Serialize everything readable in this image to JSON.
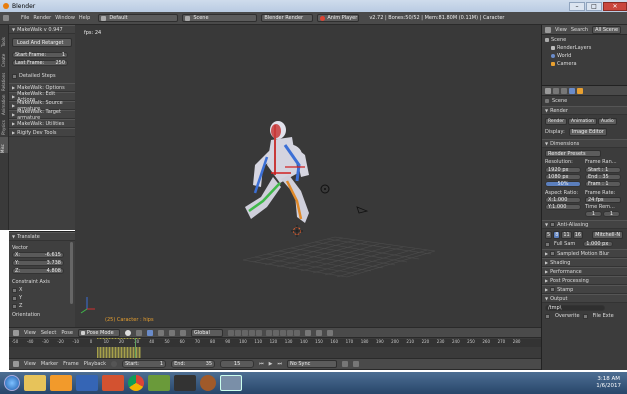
{
  "window": {
    "title": "Blender"
  },
  "menubar": {
    "menus": [
      "File",
      "Render",
      "Window",
      "Help"
    ],
    "layout": "Default",
    "scene": "Scene",
    "engine": "Blender Render",
    "anim_player": "Anim Player",
    "stats": "v2.72 | Bones:50/52 | Mem:81.80M (0.11M) | Caracter"
  },
  "tool_shelf": {
    "tabs": [
      "Tools",
      "Create",
      "Relations",
      "Animation",
      "Physics",
      "Misc"
    ],
    "makewalk_header": "MakeWalk v 0.947",
    "load_retarget": "Load And Retarget",
    "start_frame_label": "Start Frame:",
    "start_frame_value": "1",
    "last_frame_label": "Last Frame:",
    "last_frame_value": "250",
    "detailed_steps": "Detailed Steps",
    "panels": [
      "MakeWalk: Options",
      "MakeWalk: Edit Actions",
      "MakeWalk: Source armature",
      "MakeWalk: Target armature",
      "MakeWalk: Utilities",
      "Rigify Dev Tools"
    ]
  },
  "operator": {
    "header": "Translate",
    "vector_label": "Vector",
    "x_label": "X:",
    "x_value": "-6.615",
    "y_label": "Y:",
    "y_value": "3.738",
    "z_label": "Z:",
    "z_value": "4.808",
    "constraint_label": "Constraint Axis",
    "axes": [
      "X",
      "Y",
      "Z"
    ],
    "orientation": "Orientation"
  },
  "viewport": {
    "fps": "fps: 24",
    "object_label": "(25) Caracter : hips",
    "menus": [
      "View",
      "Select",
      "Pose"
    ],
    "mode": "Pose Mode",
    "orientation": "Global"
  },
  "outliner": {
    "menus": [
      "View",
      "Search",
      "All Scene"
    ],
    "items": [
      "Scene",
      "RenderLayers",
      "World",
      "Camera"
    ]
  },
  "properties": {
    "scene": "Scene",
    "render_header": "Render",
    "render_buttons": [
      "Render",
      "Animation",
      "Audio"
    ],
    "display_label": "Display:",
    "display_value": "Image Editor",
    "dimensions_header": "Dimensions",
    "render_presets": "Render Presets",
    "resolution_label": "Resolution:",
    "res_x": "1920 px",
    "res_y": "1080 px",
    "res_pct": "50%",
    "frame_range_label": "Frame Ran...",
    "start": "Start : 1",
    "end": "End : 35",
    "frame_step": "Fram : 1",
    "aspect_label": "Aspect Ratio:",
    "aspect_x": "X:1.000",
    "aspect_y": "Y:1.000",
    "frame_rate_label": "Frame Rate:",
    "fps_value": "24 fps",
    "time_remap": "Time Rem...",
    "remap_old": "1",
    "remap_new": "1",
    "anti_aliasing": "Anti-Aliasing",
    "aa_samples": [
      "5",
      "8",
      "11",
      "16"
    ],
    "aa_filter": "Mitchell-N",
    "full_sample": "Full Sam",
    "aa_size": "1.000 px",
    "collapsed": [
      "Sampled Motion Blur",
      "Shading",
      "Performance",
      "Post Processing",
      "Stamp"
    ],
    "output_header": "Output",
    "output_path": "/tmp\\",
    "overwrite": "Overwrite",
    "file_extensions": "File Exte"
  },
  "timeline": {
    "menus": [
      "View",
      "Marker",
      "Frame",
      "Playback"
    ],
    "start": "Start:",
    "start_value": "1",
    "end": "End:",
    "end_value": "35",
    "current": "15",
    "sync": "No Sync",
    "ticks": [
      "-50",
      "-40",
      "-30",
      "-20",
      "-10",
      "0",
      "10",
      "20",
      "30",
      "40",
      "50",
      "60",
      "70",
      "80",
      "90",
      "100",
      "110",
      "120",
      "130",
      "140",
      "150",
      "160",
      "170",
      "180",
      "190",
      "200",
      "210",
      "220",
      "230",
      "240",
      "250",
      "260",
      "270",
      "280"
    ]
  },
  "taskbar": {
    "time": "3:18 AM",
    "date": "1/6/2017"
  }
}
